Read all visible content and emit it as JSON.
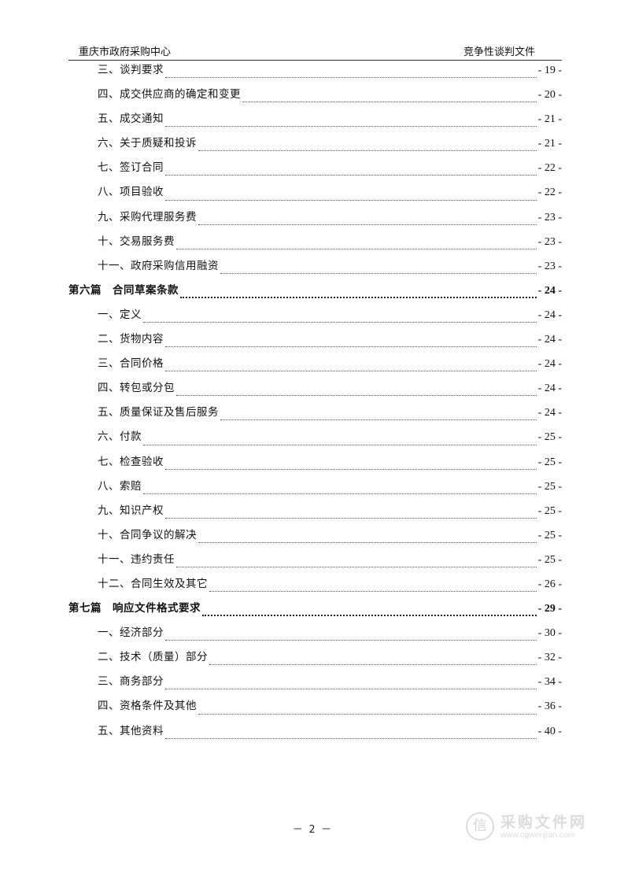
{
  "header": {
    "left": "重庆市政府采购中心",
    "right": "竞争性谈判文件"
  },
  "toc": [
    {
      "level": 2,
      "title": "三、谈判要求",
      "page": "- 19 -"
    },
    {
      "level": 2,
      "title": "四、成交供应商的确定和变更",
      "page": "- 20 -"
    },
    {
      "level": 2,
      "title": "五、成交通知",
      "page": "- 21 -"
    },
    {
      "level": 2,
      "title": "六、关于质疑和投诉",
      "page": "- 21 -"
    },
    {
      "level": 2,
      "title": "七、签订合同",
      "page": "- 22 -"
    },
    {
      "level": 2,
      "title": "八、项目验收",
      "page": "- 22 -"
    },
    {
      "level": 2,
      "title": "九、采购代理服务费",
      "page": "- 23 -"
    },
    {
      "level": 2,
      "title": "十、交易服务费",
      "page": "- 23 -"
    },
    {
      "level": 2,
      "title": "十一、政府采购信用融资",
      "page": "- 23 -"
    },
    {
      "level": 1,
      "title": "第六篇　合同草案条款",
      "page": "- 24 -"
    },
    {
      "level": 2,
      "title": "一、定义",
      "page": "- 24 -"
    },
    {
      "level": 2,
      "title": "二、货物内容",
      "page": "- 24 -"
    },
    {
      "level": 2,
      "title": "三、合同价格",
      "page": "- 24 -"
    },
    {
      "level": 2,
      "title": "四、转包或分包",
      "page": "- 24 -"
    },
    {
      "level": 2,
      "title": "五、质量保证及售后服务",
      "page": "- 24 -"
    },
    {
      "level": 2,
      "title": "六、付款",
      "page": "- 25 -"
    },
    {
      "level": 2,
      "title": "七、检查验收",
      "page": "- 25 -"
    },
    {
      "level": 2,
      "title": "八、索赔",
      "page": "- 25 -"
    },
    {
      "level": 2,
      "title": "九、知识产权",
      "page": "- 25 -"
    },
    {
      "level": 2,
      "title": "十、合同争议的解决",
      "page": "- 25 -"
    },
    {
      "level": 2,
      "title": "十一、违约责任",
      "page": "- 25 -"
    },
    {
      "level": 2,
      "title": "十二、合同生效及其它",
      "page": "- 26 -"
    },
    {
      "level": 1,
      "title": "第七篇　响应文件格式要求",
      "page": "- 29 -"
    },
    {
      "level": 2,
      "title": "一、经济部分",
      "page": "- 30 -"
    },
    {
      "level": 2,
      "title": "二、技术（质量）部分",
      "page": "- 32 -"
    },
    {
      "level": 2,
      "title": "三、商务部分",
      "page": "- 34 -"
    },
    {
      "level": 2,
      "title": "四、资格条件及其他",
      "page": "- 36 -"
    },
    {
      "level": 2,
      "title": "五、其他资料",
      "page": "- 40 -"
    }
  ],
  "footer": {
    "page_number": "－ 2 －"
  },
  "watermark": {
    "logo_glyph": "信",
    "name": "采购文件网",
    "url": "www.cgwenjian.com"
  }
}
